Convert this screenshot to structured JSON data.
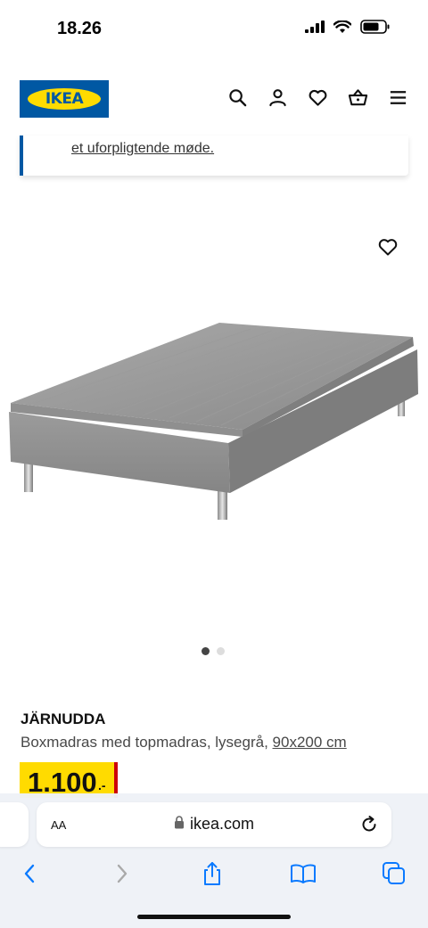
{
  "status_bar": {
    "time": "18.26"
  },
  "header": {
    "logo_text": "IKEA",
    "icons": [
      "search-icon",
      "user-icon",
      "heart-icon",
      "basket-icon",
      "menu-icon"
    ]
  },
  "info_card": {
    "link_text": "et uforpligtende møde."
  },
  "product": {
    "name": "JÄRNUDDA",
    "description": "Boxmadras med topmadras, lysegrå,",
    "size": "90x200 cm",
    "price": "1.100",
    "price_suffix": ".-",
    "image_count": 2,
    "active_image": 1
  },
  "browser": {
    "text_size_label": "AA",
    "url": "ikea.com"
  },
  "colors": {
    "ikea_blue": "#0058a3",
    "ikea_yellow": "#ffdb00",
    "price_red": "#cc0008",
    "link_blue": "#0a7aff"
  }
}
